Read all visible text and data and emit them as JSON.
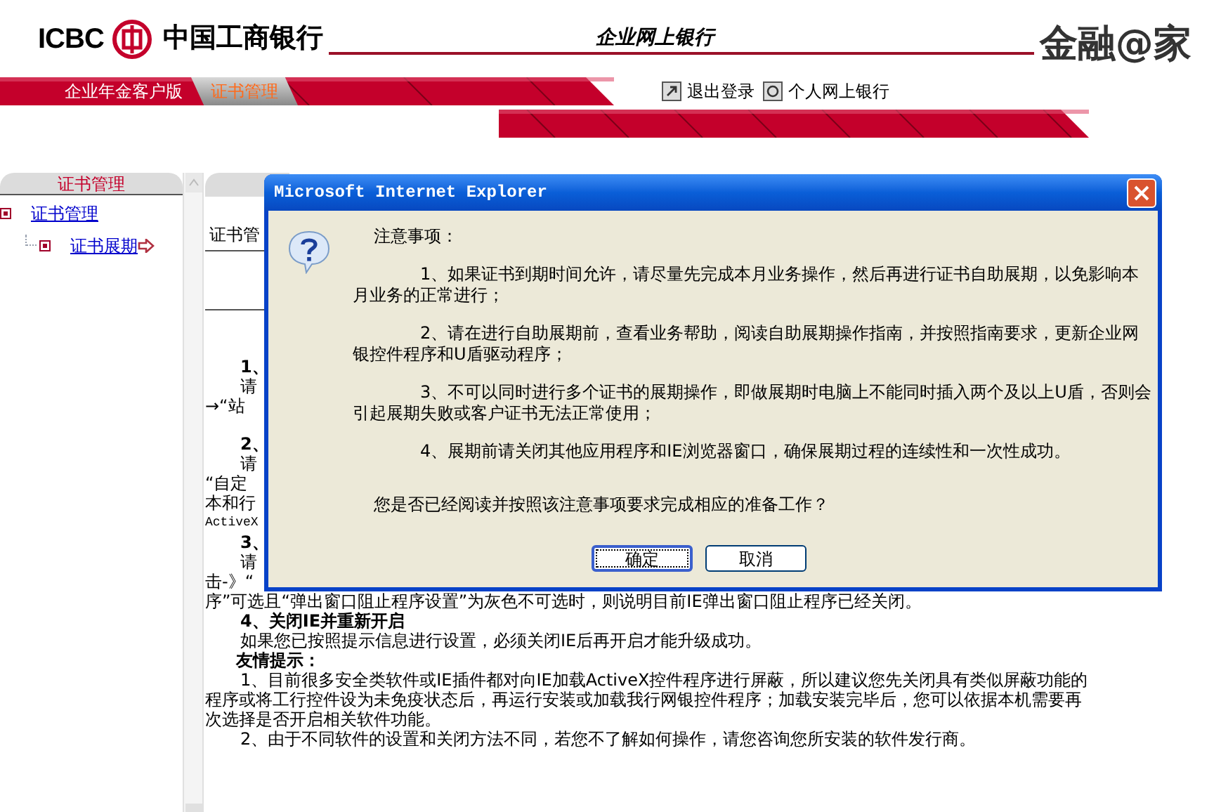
{
  "header": {
    "logo_text": "ICBC",
    "bank_name": "中国工商银行",
    "subtitle": "企业网上银行",
    "slogan": "金融@家"
  },
  "nav_tabs": [
    {
      "label": "企业年金客户版",
      "selected": false
    },
    {
      "label": "证书管理",
      "selected": true
    }
  ],
  "top_links": [
    {
      "label": "退出登录",
      "kind": "logout"
    },
    {
      "label": "个人网上银行",
      "kind": "personal"
    }
  ],
  "sidebar": {
    "title": "证书管理",
    "tree": [
      {
        "label": "证书管理",
        "selected": false,
        "children": [
          {
            "label": "证书展期",
            "selected": true
          }
        ]
      }
    ]
  },
  "content": {
    "heading": "证书管",
    "lines": [
      {
        "kind": "heading",
        "text": "1、"
      },
      {
        "kind": "para",
        "text": "请"
      },
      {
        "kind": "cont",
        "text": "→“站"
      },
      {
        "kind": "gap"
      },
      {
        "kind": "heading",
        "text": "2、"
      },
      {
        "kind": "para",
        "text": "请"
      },
      {
        "kind": "cont",
        "text": "“自定"
      },
      {
        "kind": "cont",
        "text": "本和行"
      },
      {
        "kind": "code",
        "text": "ActiveX"
      },
      {
        "kind": "heading",
        "text": "3、"
      },
      {
        "kind": "para",
        "text": "请"
      },
      {
        "kind": "cont",
        "text": "击-》“"
      },
      {
        "kind": "cont",
        "text": "序”可选且“弹出窗口阻止程序设置”为灰色不可选时，则说明目前IE弹出窗口阻止程序已经关闭。"
      },
      {
        "kind": "heading",
        "text": "4、关闭IE并重新开启"
      },
      {
        "kind": "para",
        "text": "如果您已按照提示信息进行设置，必须关闭IE后再开启才能升级成功。"
      },
      {
        "kind": "tip",
        "text": "友情提示："
      },
      {
        "kind": "para",
        "text": "1、目前很多安全类软件或IE插件都对向IE加载ActiveX控件程序进行屏蔽，所以建议您先关闭具有类似屏蔽功能的"
      },
      {
        "kind": "cont",
        "text": "程序或将工行控件设为未免疫状态后，再运行安装或加载我行网银控件程序；加载安装完毕后，您可以依据本机需要再"
      },
      {
        "kind": "cont",
        "text": "次选择是否开启相关软件功能。"
      },
      {
        "kind": "para",
        "text": "2、由于不同软件的设置和关闭方法不同，若您不了解如何操作，请您咨询您所安装的软件发行商。"
      }
    ]
  },
  "dialog": {
    "title": "Microsoft Internet Explorer",
    "notes_title": "注意事项：",
    "notes": [
      "1、如果证书到期时间允许，请尽量先完成本月业务操作，然后再进行证书自助展期，以免影响本月业务的正常进行；",
      "2、请在进行自助展期前，查看业务帮助，阅读自助展期操作指南，并按照指南要求，更新企业网银控件程序和U盾驱动程序；",
      "3、不可以同时进行多个证书的展期操作，即做展期时电脑上不能同时插入两个及以上U盾，否则会引起展期失败或客户证书无法正常使用；",
      "4、展期前请关闭其他应用程序和IE浏览器窗口，确保展期过程的连续性和一次性成功。"
    ],
    "question": "您是否已经阅读并按照该注意事项要求完成相应的准备工作？",
    "buttons": [
      {
        "label": "确定",
        "selected": true
      },
      {
        "label": "取消",
        "selected": false
      }
    ]
  }
}
